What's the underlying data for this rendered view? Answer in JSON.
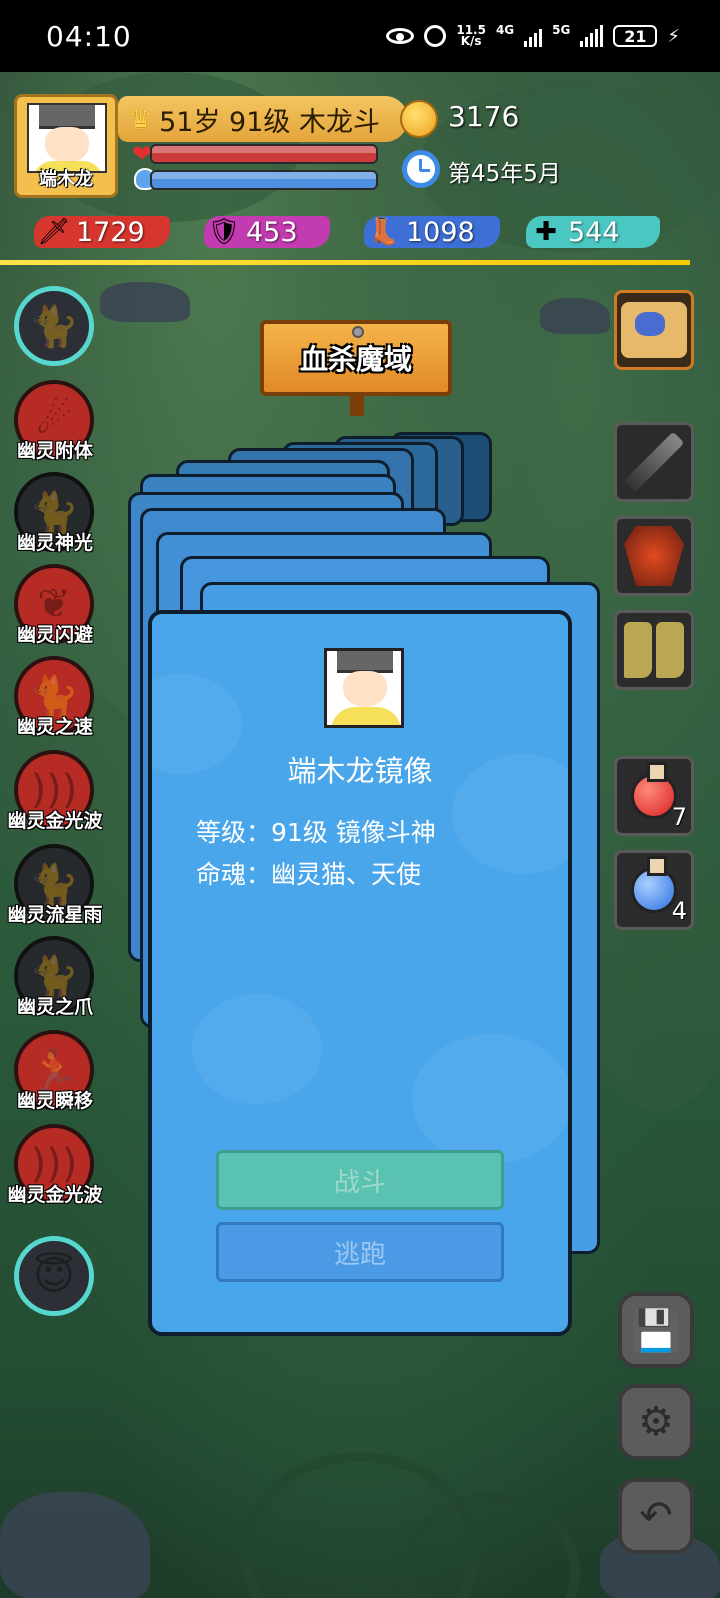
{
  "status_bar": {
    "time": "04:10",
    "net_speed_value": "11.5",
    "net_speed_unit": "K/s",
    "net_type_1": "4G",
    "net_type_2": "5G",
    "battery": "21"
  },
  "player": {
    "name": "端木龙",
    "level_text": "51岁 91级 木龙斗",
    "gold": "3176",
    "date": "第45年5月",
    "hp_fraction": 1.0,
    "mp_fraction": 1.0
  },
  "stats": {
    "attack": "1729",
    "defense": "453",
    "speed": "1098",
    "health": "544"
  },
  "location": "血杀魔域",
  "skills": [
    {
      "label": "",
      "icon": "ghost-cat-icon"
    },
    {
      "label": "幽灵附体",
      "icon": "ghost-possession-icon"
    },
    {
      "label": "幽灵神光",
      "icon": "ghost-light-icon"
    },
    {
      "label": "幽灵闪避",
      "icon": "ghost-dodge-icon"
    },
    {
      "label": "幽灵之速",
      "icon": "ghost-speed-icon"
    },
    {
      "label": "幽灵金光波",
      "icon": "ghost-wave-icon"
    },
    {
      "label": "幽灵流星雨",
      "icon": "ghost-meteor-icon"
    },
    {
      "label": "幽灵之爪",
      "icon": "ghost-claw-icon"
    },
    {
      "label": "幽灵瞬移",
      "icon": "ghost-teleport-icon"
    },
    {
      "label": "幽灵金光波",
      "icon": "ghost-wave-icon"
    },
    {
      "label": "",
      "icon": "cat-angel-icon"
    }
  ],
  "items": {
    "red_potion_count": "7",
    "blue_potion_count": "4"
  },
  "encounter": {
    "name": "端木龙镜像",
    "level_line": "等级：91级 镜像斗神",
    "soul_line": "命魂：幽灵猫、天使",
    "fight_label": "战斗",
    "flee_label": "逃跑"
  },
  "colors": {
    "hp": "#cc3b3b",
    "mp": "#4f8fe0",
    "card": "#4aa6ea",
    "accent_yellow": "#ffe34a"
  }
}
